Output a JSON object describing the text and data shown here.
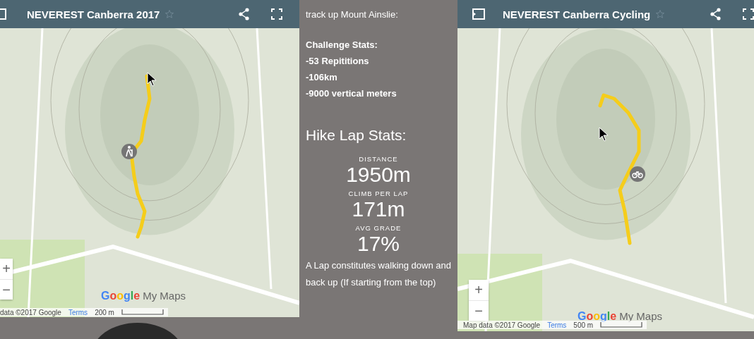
{
  "maps": [
    {
      "title": "NEVEREST Canberra 2017",
      "kind": "hike",
      "attribution": "data ©2017 Google",
      "terms": "Terms",
      "scale": "200 m",
      "logo": {
        "brand": "Google",
        "product": "My Maps"
      },
      "zoom": [
        "+",
        "−"
      ]
    },
    {
      "title": "NEVEREST Canberra Cycling",
      "kind": "bike",
      "attribution": "Map data ©2017 Google",
      "terms": "Terms",
      "scale": "500 m",
      "logo": {
        "brand": "Google",
        "product": "My Maps"
      },
      "zoom": [
        "+",
        "−"
      ]
    }
  ],
  "info": {
    "intro": "track up Mount Ainslie:",
    "challenge_title": "Challenge Stats:",
    "challenge_items": [
      "-53 Repititions",
      "-106km",
      "-9000 vertical meters"
    ],
    "lap_title": "Hike Lap Stats:",
    "stats": [
      {
        "label": "DISTANCE",
        "value": "1950m"
      },
      {
        "label": "CLIMB PER LAP",
        "value": "171m"
      },
      {
        "label": "AVG GRADE",
        "value": "17%"
      }
    ],
    "note": "A Lap constitutes walking down and back up (If starting from the top)"
  }
}
